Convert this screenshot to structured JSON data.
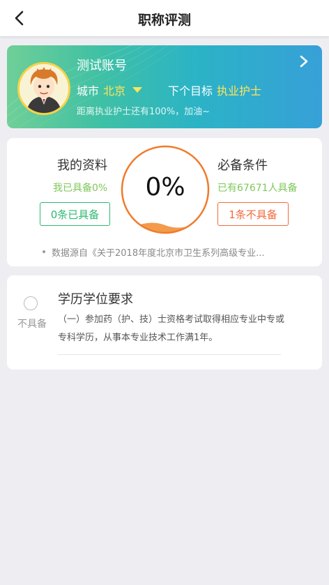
{
  "header": {
    "title": "职称评测"
  },
  "profile": {
    "account_name": "测试账号",
    "city_label": "城市",
    "city_value": "北京",
    "target_label": "下个目标",
    "target_value": "执业护士",
    "progress_text": "距离执业护士还有100%，加油~"
  },
  "stats": {
    "my_title": "我的资料",
    "my_subtitle": "我已具备0%",
    "my_button": "0条已具备",
    "gauge_value": "0%",
    "gauge_fraction": 0,
    "req_title": "必备条件",
    "req_subtitle": "已有67671人具备",
    "req_button": "1条不具备",
    "source_text": "数据源自《关于2018年度北京市卫生系列高级专业..."
  },
  "requirement": {
    "status_label": "不具备",
    "title": "学历学位要求",
    "description": "（一）参加药（护、技）士资格考试取得相应专业中专或专科学历，从事本专业技术工作满1年。"
  },
  "colors": {
    "accent_green": "#2eb872",
    "accent_orange": "#f26b3a",
    "highlight_yellow": "#ffe45c",
    "gauge_ring": "#f07a2a"
  }
}
